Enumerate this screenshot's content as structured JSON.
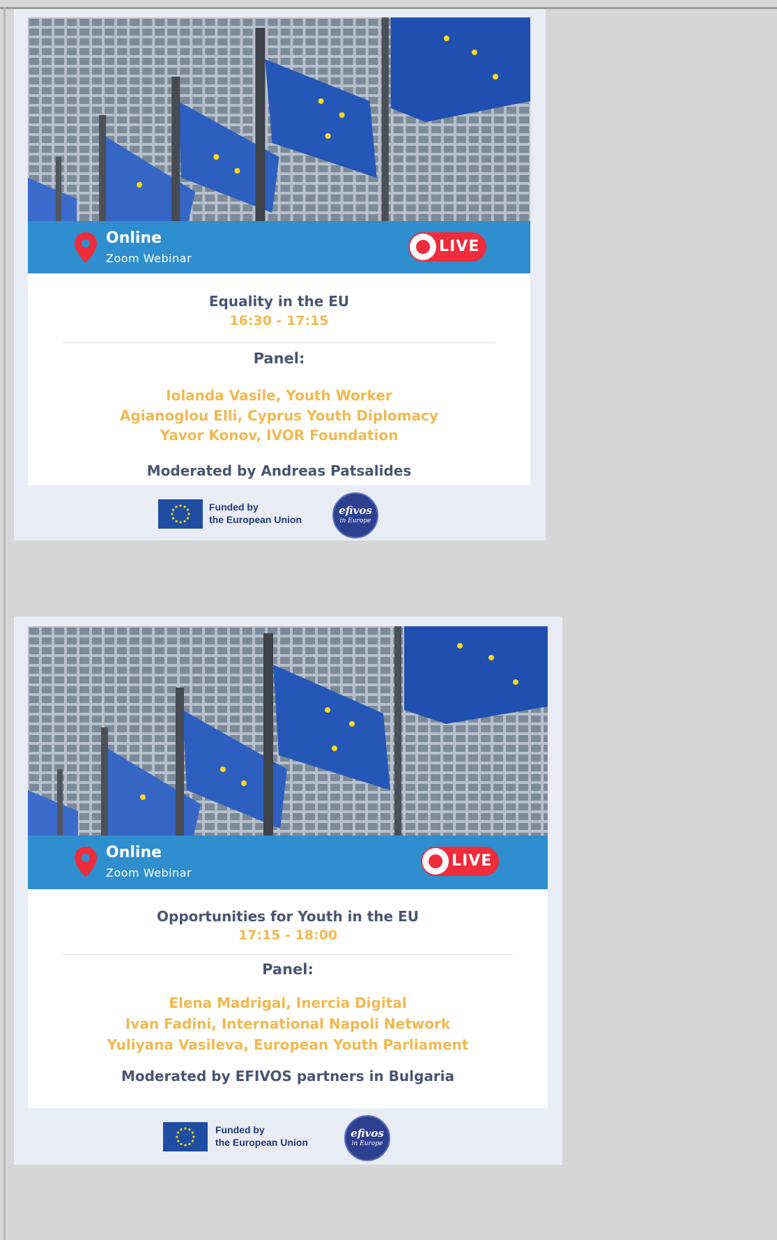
{
  "colors": {
    "background": "#d6d6d6",
    "card": "#e9ecf4",
    "banner": "#2f8ecd",
    "live_red": "#ee2c3c",
    "navy_text": "#4a5572",
    "gold_text": "#f0b94f",
    "eu_blue": "#1f4da1",
    "eu_star": "#ffd617"
  },
  "cards": [
    {
      "location": {
        "title": "Online",
        "subtitle": "Zoom Webinar",
        "icon": "map-pin-icon"
      },
      "live_label": "LIVE",
      "session": {
        "title": "Equality in the EU",
        "time": "16:30 - 17:15"
      },
      "panel_heading": "Panel:",
      "panelists": [
        "Iolanda Vasile, Youth Worker",
        "Agianoglou Elli, Cyprus Youth Diplomacy",
        "Yavor Konov, IVOR Foundation"
      ],
      "moderator": "Moderated by Andreas Patsalides",
      "footer": {
        "funded_line1": "Funded by",
        "funded_line2": "the European Union",
        "logo_name": "efivos",
        "logo_tagline": "in Europe"
      }
    },
    {
      "location": {
        "title": "Online",
        "subtitle": "Zoom Webinar",
        "icon": "map-pin-icon"
      },
      "live_label": "LIVE",
      "session": {
        "title": "Opportunities for Youth in the EU",
        "time": "17:15 - 18:00"
      },
      "panel_heading": "Panel:",
      "panelists": [
        "Elena Madrigal, Inercia Digital",
        "Ivan Fadini, International Napoli Network",
        "Yuliyana Vasileva, European Youth Parliament"
      ],
      "moderator": "Moderated by EFIVOS partners in Bulgaria",
      "footer": {
        "funded_line1": "Funded by",
        "funded_line2": "the European Union",
        "logo_name": "efivos",
        "logo_tagline": "in Europe"
      }
    }
  ]
}
